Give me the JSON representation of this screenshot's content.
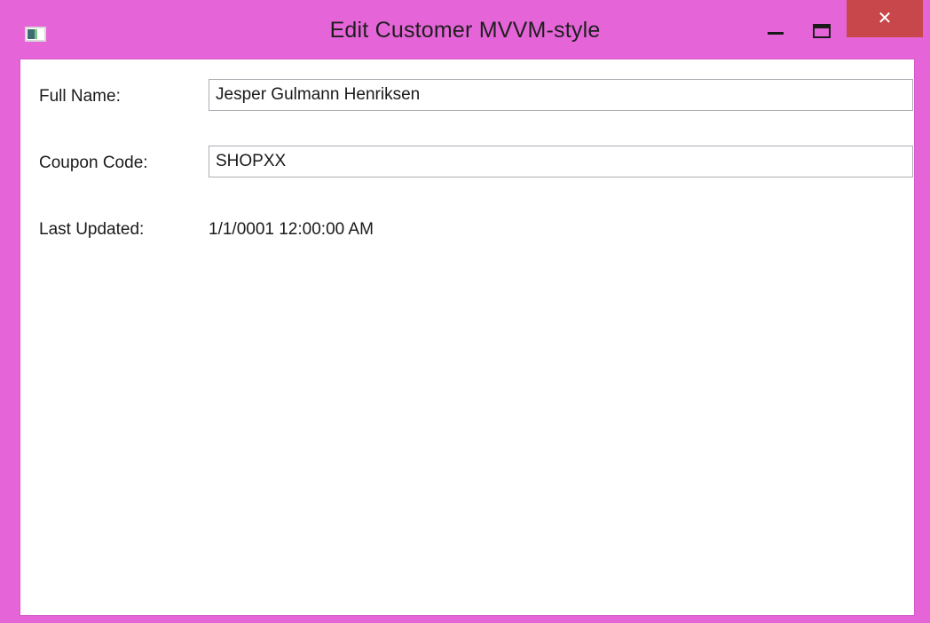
{
  "window": {
    "title": "Edit Customer MVVM-style",
    "frame_color": "#e565d8",
    "close_color": "#c7474a",
    "controls": {
      "minimize_icon": "minimize-icon",
      "maximize_icon": "maximize-icon",
      "close_icon": "close-icon",
      "close_glyph": "✕"
    }
  },
  "form": {
    "full_name": {
      "label": "Full Name:",
      "value": "Jesper Gulmann Henriksen"
    },
    "coupon_code": {
      "label": "Coupon Code:",
      "value": "SHOPXX"
    },
    "last_updated": {
      "label": "Last Updated:",
      "value": "1/1/0001 12:00:00 AM"
    }
  }
}
